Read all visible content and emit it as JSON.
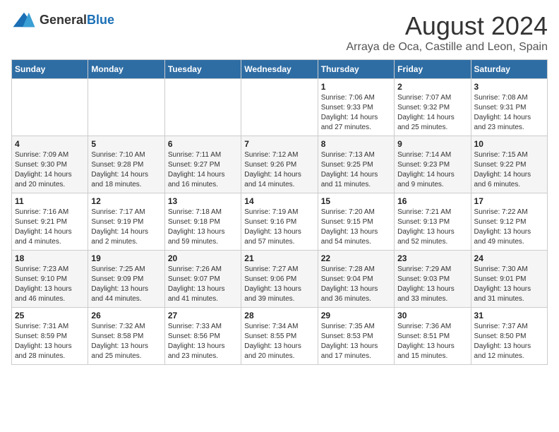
{
  "logo": {
    "general": "General",
    "blue": "Blue"
  },
  "title": {
    "month": "August 2024",
    "location": "Arraya de Oca, Castille and Leon, Spain"
  },
  "weekdays": [
    "Sunday",
    "Monday",
    "Tuesday",
    "Wednesday",
    "Thursday",
    "Friday",
    "Saturday"
  ],
  "weeks": [
    [
      {
        "day": "",
        "info": ""
      },
      {
        "day": "",
        "info": ""
      },
      {
        "day": "",
        "info": ""
      },
      {
        "day": "",
        "info": ""
      },
      {
        "day": "1",
        "info": "Sunrise: 7:06 AM\nSunset: 9:33 PM\nDaylight: 14 hours\nand 27 minutes."
      },
      {
        "day": "2",
        "info": "Sunrise: 7:07 AM\nSunset: 9:32 PM\nDaylight: 14 hours\nand 25 minutes."
      },
      {
        "day": "3",
        "info": "Sunrise: 7:08 AM\nSunset: 9:31 PM\nDaylight: 14 hours\nand 23 minutes."
      }
    ],
    [
      {
        "day": "4",
        "info": "Sunrise: 7:09 AM\nSunset: 9:30 PM\nDaylight: 14 hours\nand 20 minutes."
      },
      {
        "day": "5",
        "info": "Sunrise: 7:10 AM\nSunset: 9:28 PM\nDaylight: 14 hours\nand 18 minutes."
      },
      {
        "day": "6",
        "info": "Sunrise: 7:11 AM\nSunset: 9:27 PM\nDaylight: 14 hours\nand 16 minutes."
      },
      {
        "day": "7",
        "info": "Sunrise: 7:12 AM\nSunset: 9:26 PM\nDaylight: 14 hours\nand 14 minutes."
      },
      {
        "day": "8",
        "info": "Sunrise: 7:13 AM\nSunset: 9:25 PM\nDaylight: 14 hours\nand 11 minutes."
      },
      {
        "day": "9",
        "info": "Sunrise: 7:14 AM\nSunset: 9:23 PM\nDaylight: 14 hours\nand 9 minutes."
      },
      {
        "day": "10",
        "info": "Sunrise: 7:15 AM\nSunset: 9:22 PM\nDaylight: 14 hours\nand 6 minutes."
      }
    ],
    [
      {
        "day": "11",
        "info": "Sunrise: 7:16 AM\nSunset: 9:21 PM\nDaylight: 14 hours\nand 4 minutes."
      },
      {
        "day": "12",
        "info": "Sunrise: 7:17 AM\nSunset: 9:19 PM\nDaylight: 14 hours\nand 2 minutes."
      },
      {
        "day": "13",
        "info": "Sunrise: 7:18 AM\nSunset: 9:18 PM\nDaylight: 13 hours\nand 59 minutes."
      },
      {
        "day": "14",
        "info": "Sunrise: 7:19 AM\nSunset: 9:16 PM\nDaylight: 13 hours\nand 57 minutes."
      },
      {
        "day": "15",
        "info": "Sunrise: 7:20 AM\nSunset: 9:15 PM\nDaylight: 13 hours\nand 54 minutes."
      },
      {
        "day": "16",
        "info": "Sunrise: 7:21 AM\nSunset: 9:13 PM\nDaylight: 13 hours\nand 52 minutes."
      },
      {
        "day": "17",
        "info": "Sunrise: 7:22 AM\nSunset: 9:12 PM\nDaylight: 13 hours\nand 49 minutes."
      }
    ],
    [
      {
        "day": "18",
        "info": "Sunrise: 7:23 AM\nSunset: 9:10 PM\nDaylight: 13 hours\nand 46 minutes."
      },
      {
        "day": "19",
        "info": "Sunrise: 7:25 AM\nSunset: 9:09 PM\nDaylight: 13 hours\nand 44 minutes."
      },
      {
        "day": "20",
        "info": "Sunrise: 7:26 AM\nSunset: 9:07 PM\nDaylight: 13 hours\nand 41 minutes."
      },
      {
        "day": "21",
        "info": "Sunrise: 7:27 AM\nSunset: 9:06 PM\nDaylight: 13 hours\nand 39 minutes."
      },
      {
        "day": "22",
        "info": "Sunrise: 7:28 AM\nSunset: 9:04 PM\nDaylight: 13 hours\nand 36 minutes."
      },
      {
        "day": "23",
        "info": "Sunrise: 7:29 AM\nSunset: 9:03 PM\nDaylight: 13 hours\nand 33 minutes."
      },
      {
        "day": "24",
        "info": "Sunrise: 7:30 AM\nSunset: 9:01 PM\nDaylight: 13 hours\nand 31 minutes."
      }
    ],
    [
      {
        "day": "25",
        "info": "Sunrise: 7:31 AM\nSunset: 8:59 PM\nDaylight: 13 hours\nand 28 minutes."
      },
      {
        "day": "26",
        "info": "Sunrise: 7:32 AM\nSunset: 8:58 PM\nDaylight: 13 hours\nand 25 minutes."
      },
      {
        "day": "27",
        "info": "Sunrise: 7:33 AM\nSunset: 8:56 PM\nDaylight: 13 hours\nand 23 minutes."
      },
      {
        "day": "28",
        "info": "Sunrise: 7:34 AM\nSunset: 8:55 PM\nDaylight: 13 hours\nand 20 minutes."
      },
      {
        "day": "29",
        "info": "Sunrise: 7:35 AM\nSunset: 8:53 PM\nDaylight: 13 hours\nand 17 minutes."
      },
      {
        "day": "30",
        "info": "Sunrise: 7:36 AM\nSunset: 8:51 PM\nDaylight: 13 hours\nand 15 minutes."
      },
      {
        "day": "31",
        "info": "Sunrise: 7:37 AM\nSunset: 8:50 PM\nDaylight: 13 hours\nand 12 minutes."
      }
    ]
  ]
}
